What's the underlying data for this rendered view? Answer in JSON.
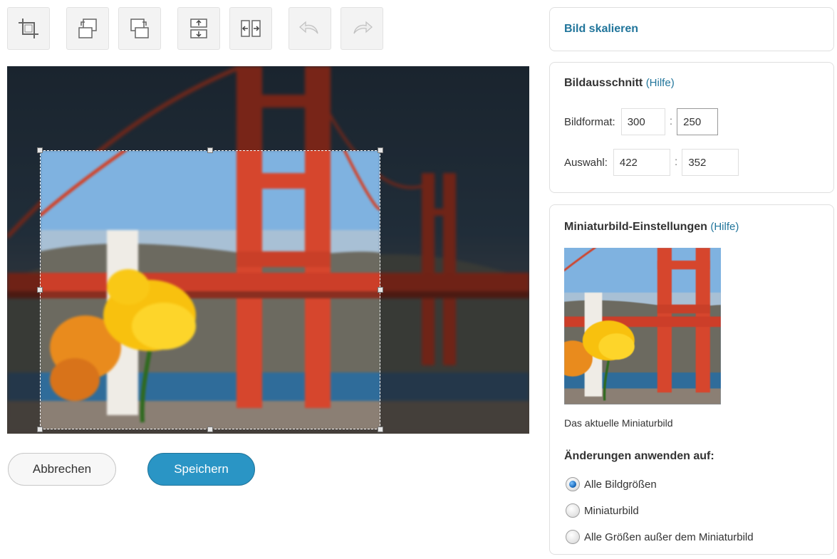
{
  "toolbar": {
    "tools": [
      {
        "name": "crop-icon",
        "enabled": true
      },
      {
        "name": "rotate-left-icon",
        "enabled": true
      },
      {
        "name": "rotate-right-icon",
        "enabled": true
      },
      {
        "name": "flip-vertical-icon",
        "enabled": true
      },
      {
        "name": "flip-horizontal-icon",
        "enabled": true
      },
      {
        "name": "undo-icon",
        "enabled": false
      },
      {
        "name": "redo-icon",
        "enabled": false
      }
    ]
  },
  "editor": {
    "image_description_icon": "golden-gate-bridge-with-flower-photo",
    "cancel_label": "Abbrechen",
    "save_label": "Speichern"
  },
  "scale_panel": {
    "title": "Bild skalieren"
  },
  "crop_panel": {
    "title": "Bildausschnitt",
    "help_label": "(Hilfe)",
    "aspect_label": "Bildformat:",
    "aspect_width": "300",
    "aspect_height": "250",
    "selection_label": "Auswahl:",
    "selection_width": "422",
    "selection_height": "352",
    "separator": ":"
  },
  "thumbnail_panel": {
    "title": "Miniaturbild-Einstellungen",
    "help_label": "(Hilfe)",
    "caption": "Das aktuelle Miniaturbild",
    "apply_title": "Änderungen anwenden auf:",
    "options": [
      {
        "label": "Alle Bildgrößen",
        "checked": true
      },
      {
        "label": "Miniaturbild",
        "checked": false
      },
      {
        "label": "Alle Größen außer dem Miniaturbild",
        "checked": false
      }
    ]
  },
  "colors": {
    "accent_blue": "#21759b",
    "save_button": "#2a95c5",
    "bridge_red": "#c0392b",
    "flower_yellow": "#f7b500"
  }
}
